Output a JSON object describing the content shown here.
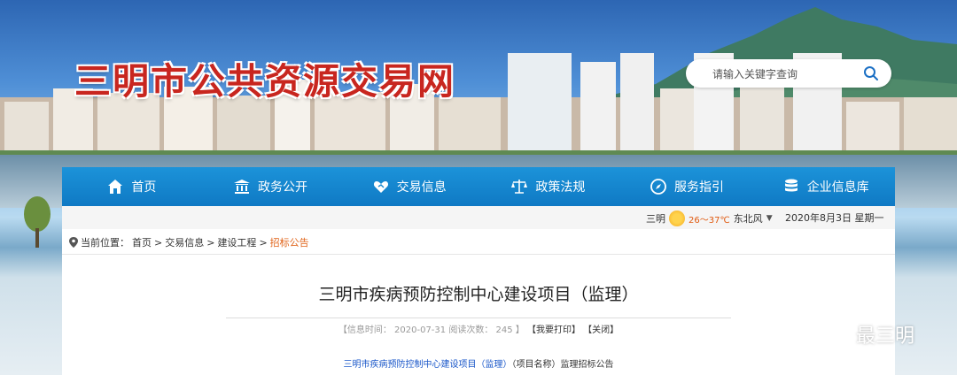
{
  "site": {
    "title": "三明市公共资源交易网"
  },
  "search": {
    "placeholder": "请输入关键字查询",
    "icon": "search-icon"
  },
  "nav": {
    "items": [
      {
        "label": "首页",
        "icon": "home-icon"
      },
      {
        "label": "政务公开",
        "icon": "government-building-icon"
      },
      {
        "label": "交易信息",
        "icon": "handshake-icon"
      },
      {
        "label": "政策法规",
        "icon": "scale-icon"
      },
      {
        "label": "服务指引",
        "icon": "compass-icon"
      },
      {
        "label": "企业信息库",
        "icon": "database-icon"
      }
    ]
  },
  "weather": {
    "city": "三明",
    "temp": "26～37℃",
    "wind": "东北风",
    "icon": "sunny-icon"
  },
  "date": "2020年8月3日  星期一",
  "breadcrumb": {
    "prefix": "当前位置：",
    "items": [
      "首页",
      "交易信息",
      "建设工程"
    ],
    "current": "招标公告",
    "sep": ">"
  },
  "article": {
    "title": "三明市疾病预防控制中心建设项目（监理）",
    "meta_info": "【信息时间：  2020-07-31  阅读次数：  245 】",
    "print_label": "【我要打印】",
    "close_label": "【关闭】",
    "body_highlight": "三明市疾病预防控制中心建设项目（监理）",
    "body_rest": "（项目名称）监理招标公告"
  },
  "watermark": {
    "text": "最三明",
    "icon": "wechat-icon"
  },
  "colors": {
    "nav_blue": "#1587d0",
    "title_red": "#c8261f",
    "highlight_blue": "#1a57c9",
    "current_orange": "#e0641a"
  }
}
